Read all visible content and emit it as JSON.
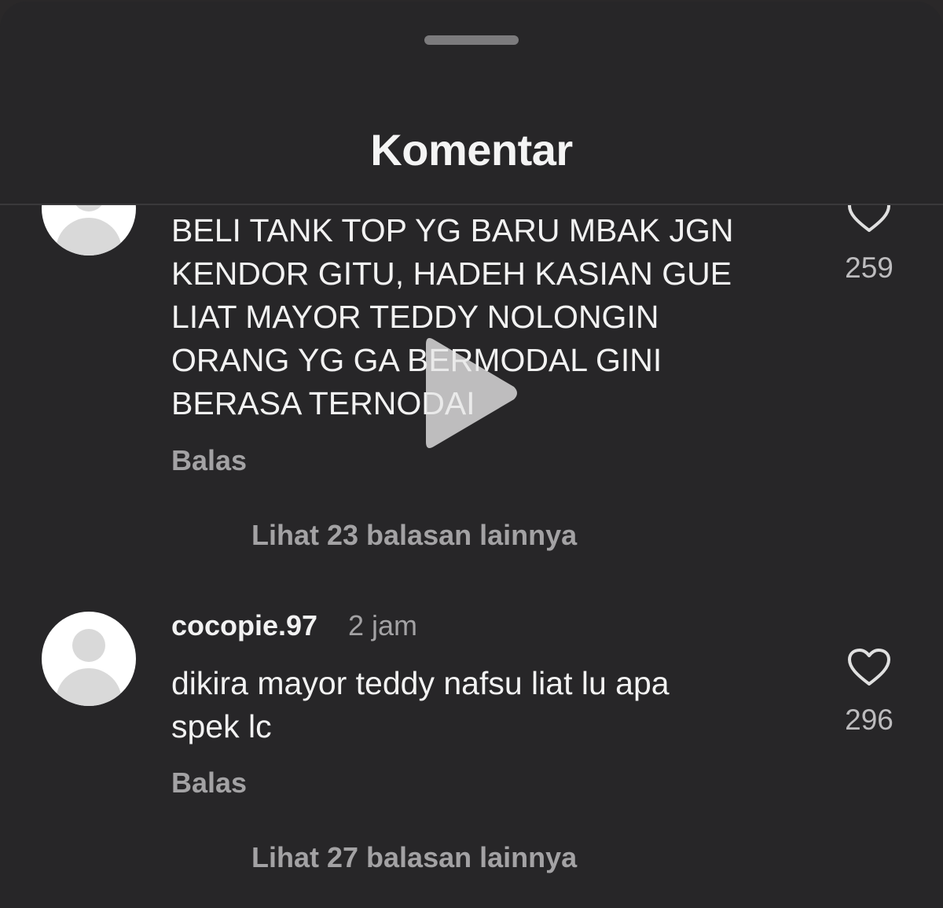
{
  "sheet": {
    "title": "Komentar"
  },
  "comments": [
    {
      "username": "",
      "text": "BELI TANK TOP YG BARU MBAK JGN\nKENDOR GITU, HADEH KASIAN GUE\nLIAT MAYOR TEDDY NOLONGIN\nORANG YG GA BERMODAL GINI\nBERASA TERNODAI",
      "reply_label": "Balas",
      "view_replies_label": "Lihat 23 balasan lainnya",
      "like_count": "259"
    },
    {
      "username": "cocopie.97",
      "timestamp": "2 jam",
      "text": "dikira mayor teddy nafsu liat lu apa\nspek lc",
      "reply_label": "Balas",
      "view_replies_label": "Lihat 27 balasan lainnya",
      "like_count": "296"
    }
  ],
  "colors": {
    "sheet_background": "#272628",
    "primary_text": "#f2f2f2",
    "secondary_text": "#a3a2a4"
  },
  "icons": {
    "like": "heart-outline-icon",
    "video_overlay": "play-icon",
    "avatar": "default-avatar-icon"
  }
}
